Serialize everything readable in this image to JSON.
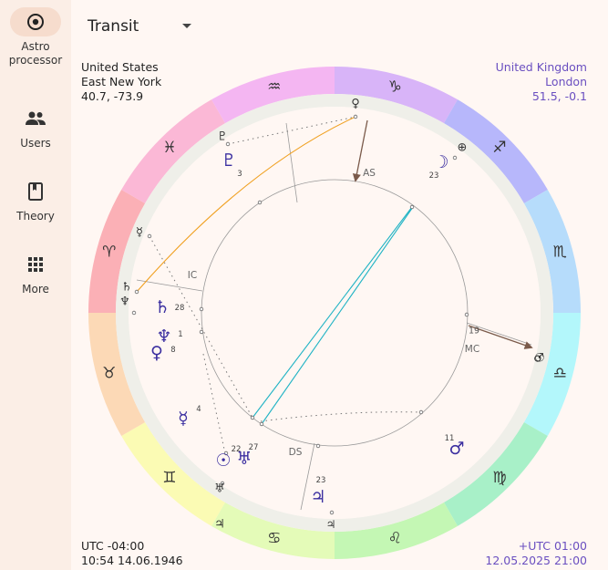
{
  "sidebar": {
    "items": [
      {
        "label": "Astro processor",
        "icon": "target-icon",
        "active": true
      },
      {
        "label": "Users",
        "icon": "users-icon"
      },
      {
        "label": "Theory",
        "icon": "book-icon"
      },
      {
        "label": "More",
        "icon": "grid-icon"
      }
    ]
  },
  "mode_select": {
    "value": "Transit"
  },
  "natal": {
    "country": "United States",
    "city": "East New York",
    "coords": "40.7, -73.9",
    "utc": "UTC -04:00",
    "datetime": "10:54 14.06.1946"
  },
  "transit": {
    "country": "United Kingdom",
    "city": "London",
    "coords": "51.5, -0.1",
    "utc": "+UTC 01:00",
    "datetime": "12.05.2025 21:00"
  },
  "colors": {
    "accent": "#6a4fc0",
    "aspect_trine": "#1fb3c4",
    "aspect_square": "#f0a020",
    "axis": "#7a5a4a"
  },
  "axes": {
    "as": "AS",
    "mc": "MC",
    "ds": "DS",
    "ic": "IC"
  },
  "zodiac": [
    {
      "sign": "capricorn",
      "glyph": "♑",
      "color": "#d8b4f8"
    },
    {
      "sign": "sagittarius",
      "glyph": "♐",
      "color": "#b7b7fb"
    },
    {
      "sign": "scorpio",
      "glyph": "♏",
      "color": "#b6dcfb"
    },
    {
      "sign": "libra",
      "glyph": "♎",
      "color": "#b3f7fb"
    },
    {
      "sign": "virgo",
      "glyph": "♍",
      "color": "#a8f0c8"
    },
    {
      "sign": "leo",
      "glyph": "♌",
      "color": "#c4f7b4"
    },
    {
      "sign": "cancer",
      "glyph": "♋",
      "color": "#e4fbb8"
    },
    {
      "sign": "gemini",
      "glyph": "♊",
      "color": "#fbfbb4"
    },
    {
      "sign": "taurus",
      "glyph": "♉",
      "color": "#fcd9b6"
    },
    {
      "sign": "aries",
      "glyph": "♈",
      "color": "#fbb0b6"
    },
    {
      "sign": "pisces",
      "glyph": "♓",
      "color": "#fbb8d6"
    },
    {
      "sign": "aquarius",
      "glyph": "♒",
      "color": "#f4b6f2"
    }
  ],
  "natal_planets": [
    {
      "name": "pluto",
      "glyph": "♇",
      "degree": "3"
    },
    {
      "name": "moon",
      "glyph": "☽",
      "degree": "23"
    },
    {
      "name": "saturn",
      "glyph": "♄",
      "degree": "28"
    },
    {
      "name": "neptune",
      "glyph": "♆",
      "degree": "1"
    },
    {
      "name": "venus",
      "glyph": "♀",
      "degree": "8"
    },
    {
      "name": "mercury",
      "glyph": "☿",
      "degree": "4"
    },
    {
      "name": "sun",
      "glyph": "☉",
      "degree": "22"
    },
    {
      "name": "uranus",
      "glyph": "♅",
      "degree": "27"
    },
    {
      "name": "jupiter",
      "glyph": "♃",
      "degree": "23"
    },
    {
      "name": "mars",
      "glyph": "♂",
      "degree": "11"
    }
  ],
  "mc_degree": "19",
  "transit_planets": [
    {
      "name": "venus",
      "glyph": "♀"
    },
    {
      "name": "pluto",
      "glyph": "♇"
    },
    {
      "name": "part-of-fortune",
      "glyph": "⊕"
    },
    {
      "name": "mercury",
      "glyph": "☿"
    },
    {
      "name": "saturn",
      "glyph": "♄"
    },
    {
      "name": "neptune",
      "glyph": "♆"
    },
    {
      "name": "sun",
      "glyph": "☉"
    },
    {
      "name": "uranus",
      "glyph": "♅"
    },
    {
      "name": "jupiter",
      "glyph": "♃"
    },
    {
      "name": "mars",
      "glyph": "♂"
    }
  ]
}
